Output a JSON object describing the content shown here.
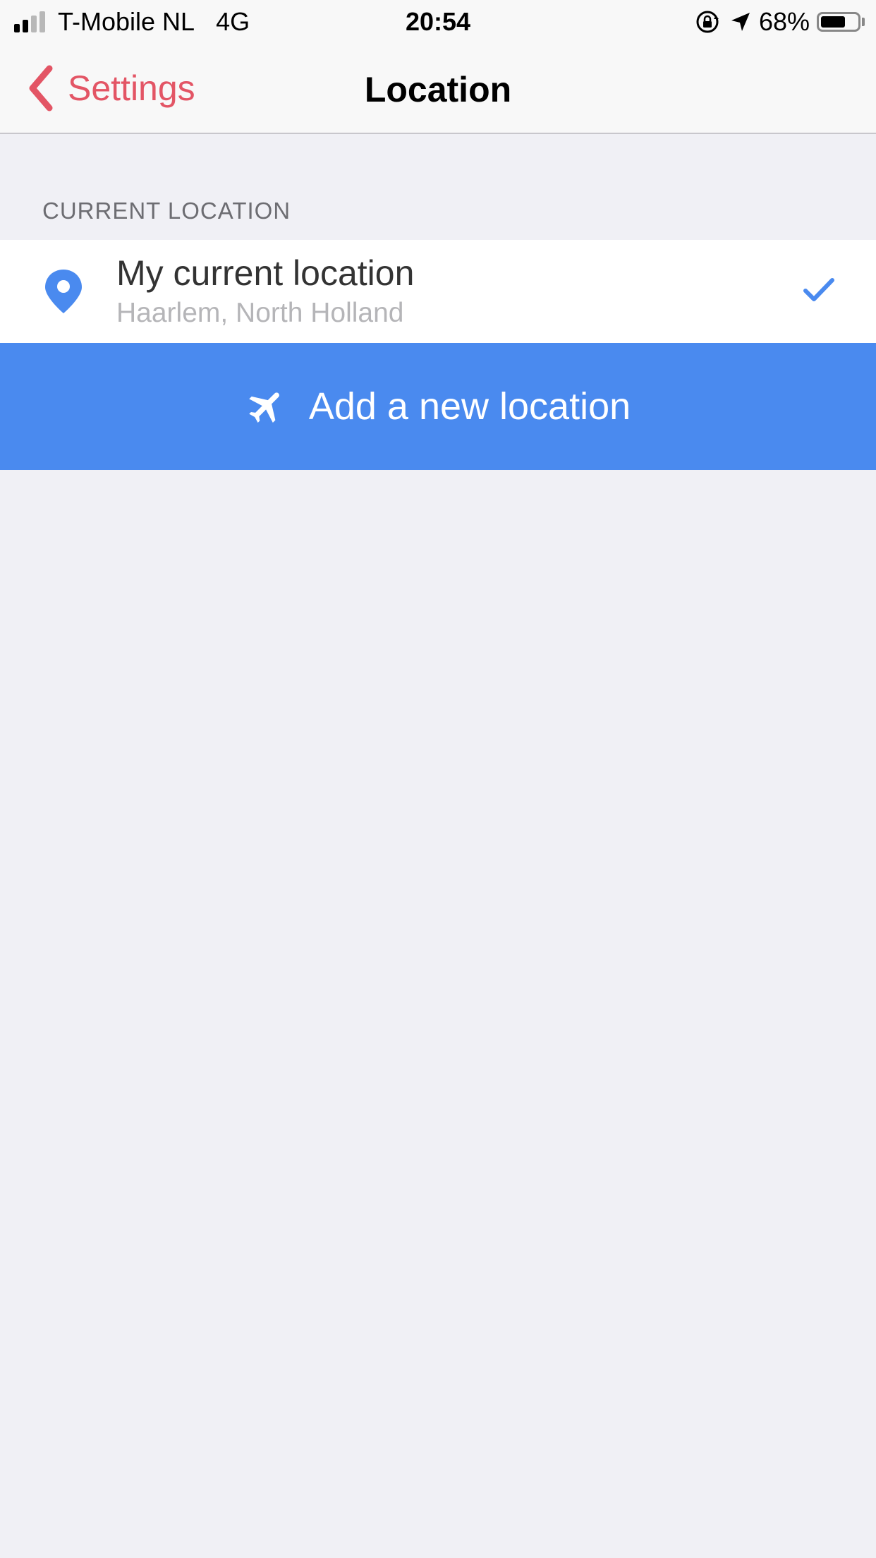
{
  "status_bar": {
    "carrier": "T-Mobile NL",
    "network": "4G",
    "time": "20:54",
    "battery": "68%",
    "battery_level": 0.68,
    "signal_bars": 2,
    "icons": [
      "signal-icon",
      "orientation-lock-icon",
      "location-arrow-icon",
      "battery-icon"
    ]
  },
  "nav": {
    "back_label": "Settings",
    "title": "Location",
    "back_icon": "chevron-left-icon"
  },
  "section": {
    "header": "CURRENT LOCATION"
  },
  "current_location": {
    "title": "My current location",
    "subtitle": "Haarlem, North Holland",
    "selected": true,
    "icon": "map-pin-icon"
  },
  "add_location": {
    "label": "Add a new location",
    "icon": "airplane-icon"
  },
  "colors": {
    "accent_red": "#e35565",
    "accent_blue": "#4a8aef",
    "background": "#f0f0f5"
  }
}
